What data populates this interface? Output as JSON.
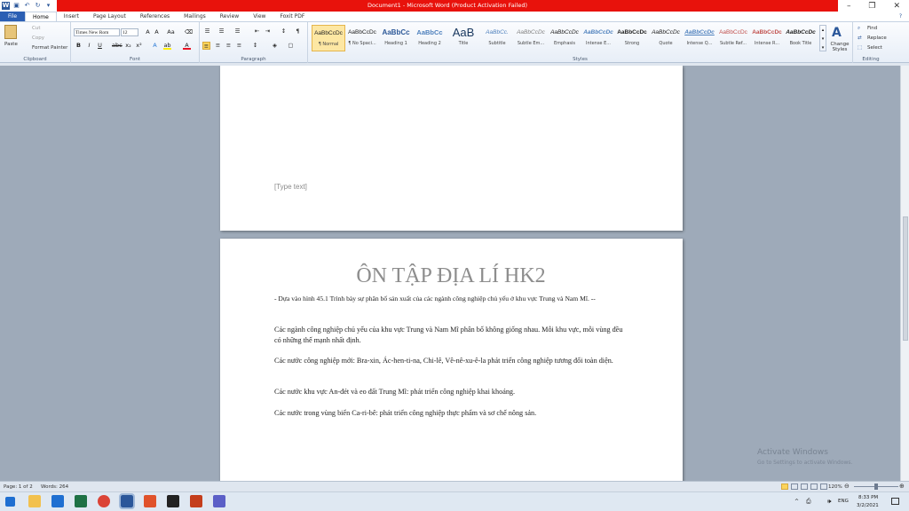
{
  "window": {
    "title": "Document1 - Microsoft Word (Product Activation Failed)",
    "title_color": "#e8120c"
  },
  "ribbon_tabs": [
    "File",
    "Home",
    "Insert",
    "Page Layout",
    "References",
    "Mailings",
    "Review",
    "View",
    "Foxit PDF"
  ],
  "clipboard": {
    "paste": "Paste",
    "cut": "Cut",
    "copy": "Copy",
    "format_painter": "Format Painter",
    "label": "Clipboard"
  },
  "font": {
    "name": "Times New Rom",
    "size": "12",
    "label": "Font"
  },
  "paragraph": {
    "label": "Paragraph"
  },
  "styles": {
    "label": "Styles",
    "items": [
      {
        "preview": "AaBbCcDc",
        "name": "¶ Normal"
      },
      {
        "preview": "AaBbCcDc",
        "name": "¶ No Spaci..."
      },
      {
        "preview": "AaBbCc",
        "name": "Heading 1"
      },
      {
        "preview": "AaBbCc",
        "name": "Heading 2"
      },
      {
        "preview": "AaB",
        "name": "Title"
      },
      {
        "preview": "AaBbCc.",
        "name": "Subtitle"
      },
      {
        "preview": "AaBbCcDc",
        "name": "Subtle Em..."
      },
      {
        "preview": "AaBbCcDc",
        "name": "Emphasis"
      },
      {
        "preview": "AaBbCcDc",
        "name": "Intense E..."
      },
      {
        "preview": "AaBbCcDc",
        "name": "Strong"
      },
      {
        "preview": "AaBbCcDc",
        "name": "Quote"
      },
      {
        "preview": "AaBbCcDc",
        "name": "Intense Q..."
      },
      {
        "preview": "AaBbCcDc",
        "name": "Subtle Ref..."
      },
      {
        "preview": "AaBbCcDc",
        "name": "Intense R..."
      },
      {
        "preview": "AaBbCcDc",
        "name": "Book Title"
      }
    ],
    "change_styles": "Change Styles"
  },
  "editing": {
    "label": "Editing",
    "find": "Find",
    "replace": "Replace",
    "select": "Select"
  },
  "document": {
    "header_placeholder": "[Type text]",
    "title": "ÔN TẬP ĐỊA LÍ HK2",
    "paragraphs": [
      "- Dựa vào hình 45.1 Trình bày sự phân bố sản xuất của các ngành công nghiệp chủ yếu ở khu vực Trung và Nam Mĩ. --",
      "Các ngành công nghiệp chủ yếu của khu vực Trung và Nam Mĩ phân bố không giống nhau. Mỗi khu vực, mỗi vùng đều có những thế mạnh nhất định.",
      "Các nước công nghiệp mới: Bra-xin, Ác-hen-ti-na, Chi-lê, Vê-nê-xu-ê-la phát triển công nghiệp tương đối toàn diện.",
      "Các nước khu vực An-đét và eo đất Trung Mĩ: phát triển công nghiệp khai khoáng.",
      "Các nước trong vùng biển Ca-ri-bê: phát triển công nghiệp thực phẩm và sơ chế nông sản."
    ]
  },
  "status": {
    "page": "Page: 1 of 2",
    "words": "Words: 264",
    "zoom": "120%"
  },
  "watermark": {
    "title": "Activate Windows",
    "subtitle": "Go to Settings to activate Windows."
  },
  "taskbar": {
    "lang": "ENG",
    "time": "8:33 PM",
    "date": "3/2/2021"
  }
}
